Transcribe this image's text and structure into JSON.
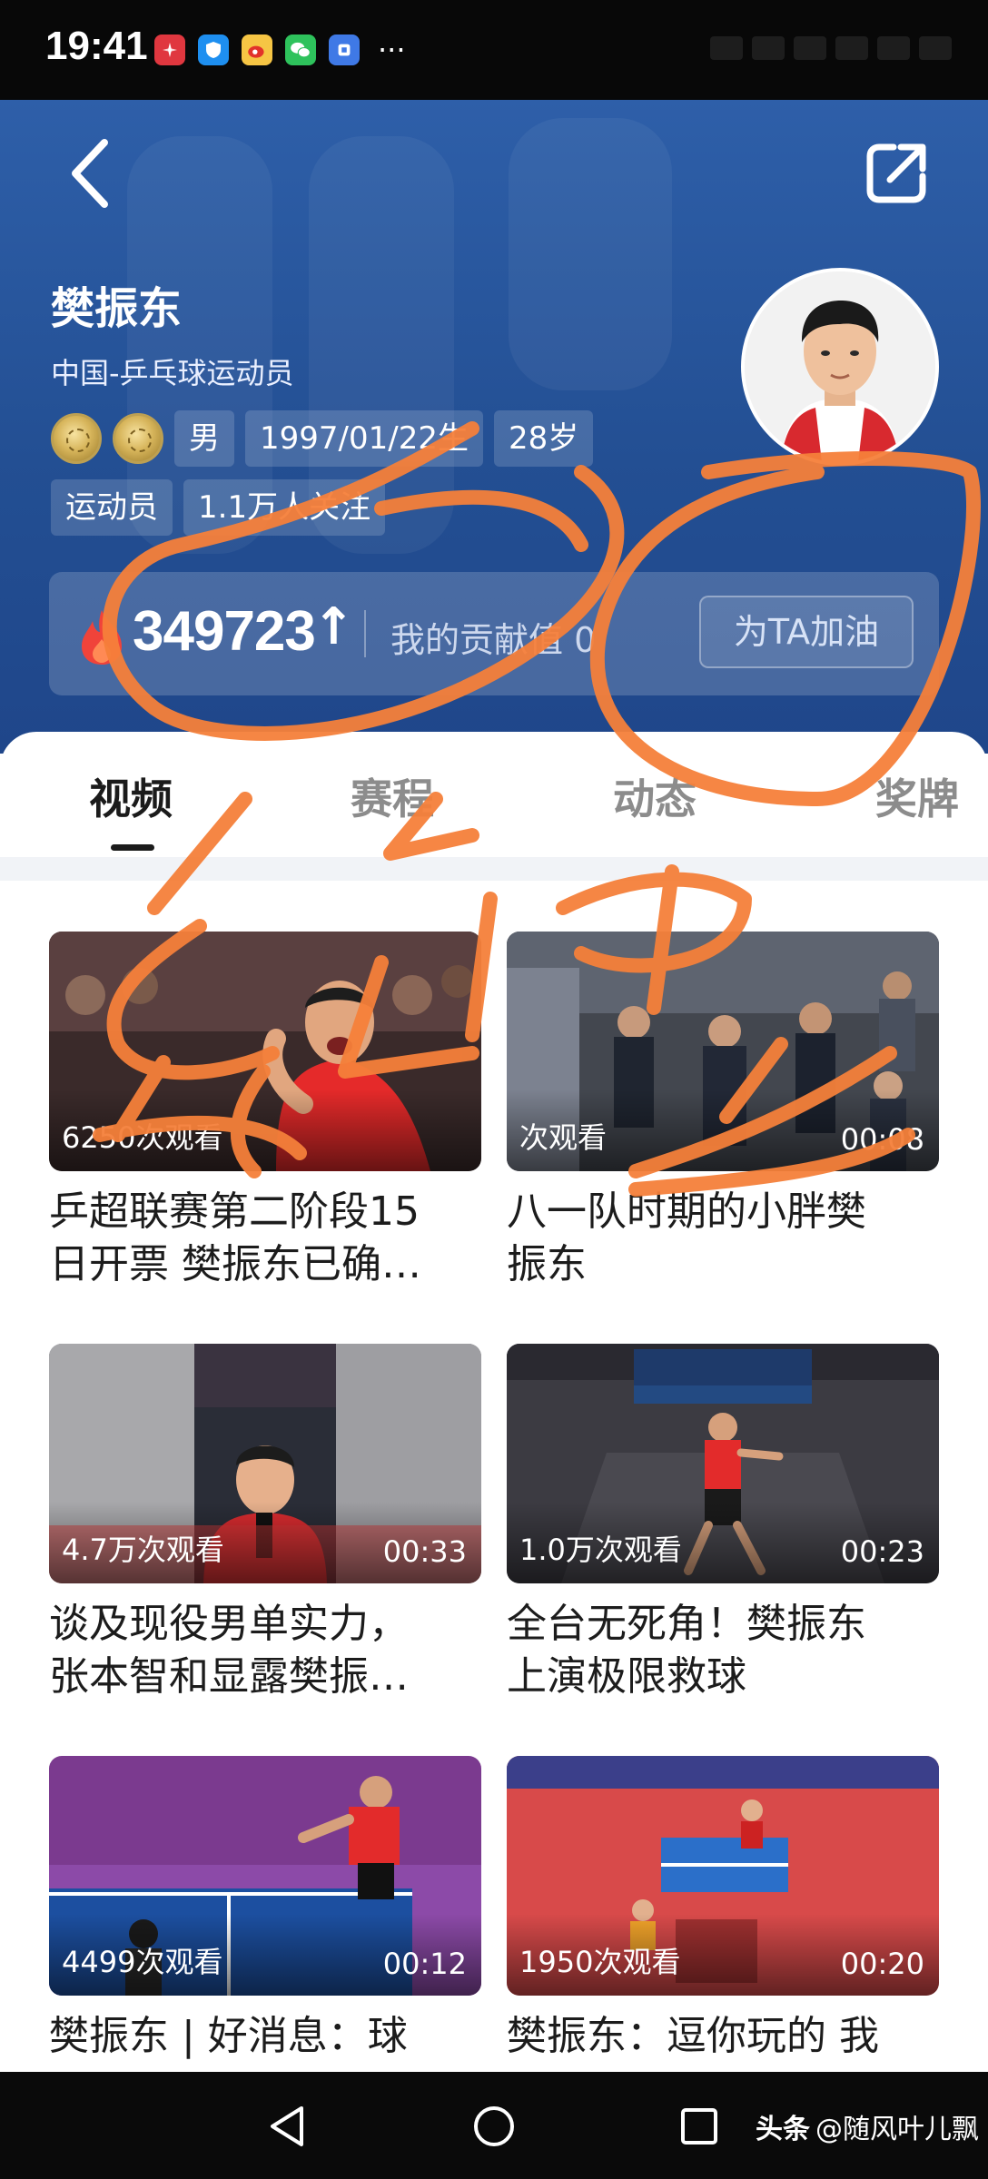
{
  "status_bar": {
    "time": "19:41",
    "app_icons": [
      "huawei-icon",
      "shield-icon",
      "weibo-icon",
      "wechat-icon",
      "app-icon"
    ],
    "more": "···"
  },
  "header": {
    "name": "樊振东",
    "subtitle": "中国-乒乓球运动员",
    "tags_row1": [
      "男",
      "1997/01/22生",
      "28岁"
    ],
    "tags_row2": [
      "运动员",
      "1.1万人关注"
    ],
    "medals": [
      "gold-medal-icon",
      "gold-medal-icon"
    ],
    "stat": {
      "score": "349723",
      "arrow": "↑",
      "contribution": "我的贡献值 0",
      "cheer_button": "为TA加油"
    }
  },
  "tabs": [
    {
      "label": "视频",
      "active": true
    },
    {
      "label": "赛程",
      "active": false
    },
    {
      "label": "动态",
      "active": false
    },
    {
      "label": "奖牌",
      "active": false
    }
  ],
  "videos": [
    {
      "views": "6250次观看",
      "duration": "",
      "title": [
        "乒超联赛第二阶段15",
        "日开票 樊振东已确…"
      ]
    },
    {
      "views": "次观看",
      "duration": "00:08",
      "title": [
        "八一队时期的小胖樊",
        "振东"
      ]
    },
    {
      "views": "4.7万次观看",
      "duration": "00:33",
      "title": [
        "谈及现役男单实力，",
        "张本智和显露樊振…"
      ]
    },
    {
      "views": "1.0万次观看",
      "duration": "00:23",
      "title": [
        "全台无死角！樊振东",
        "上演极限救球"
      ]
    },
    {
      "views": "4499次观看",
      "duration": "00:12",
      "title": [
        "樊振东 | 好消息：球",
        ""
      ]
    },
    {
      "views": "1950次观看",
      "duration": "00:20",
      "title": [
        "樊振东：逗你玩的 我",
        ""
      ]
    }
  ],
  "watermark": {
    "brand": "头条",
    "handle": "@随风叶儿飘"
  },
  "colors": {
    "header_blue": "#2e5fa9",
    "scribble_orange": "#f5803a",
    "tab_active": "#1b1b1b",
    "tab_inactive": "#8c8c8c"
  }
}
